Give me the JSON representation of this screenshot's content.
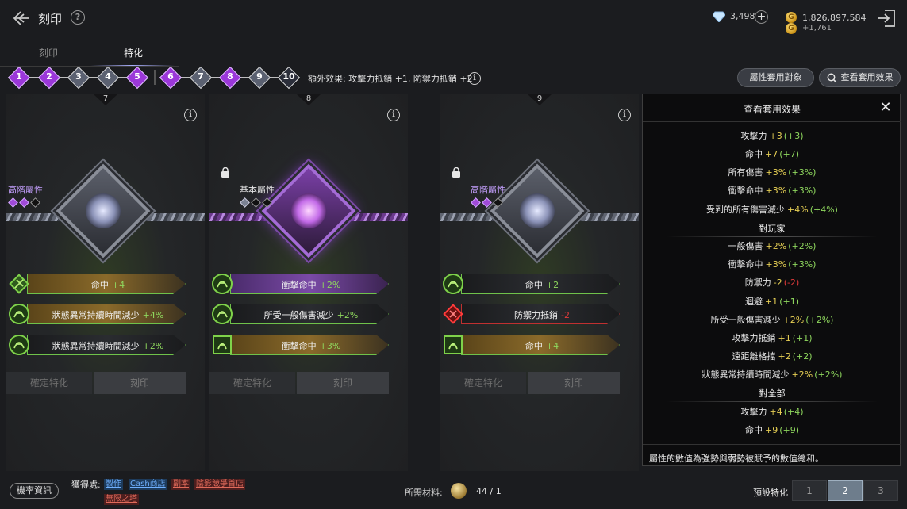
{
  "header": {
    "title": "刻印",
    "diamonds": "3,498",
    "gold": "1,826,897,584",
    "gold_sub": "+1,761"
  },
  "tabs": [
    {
      "label": "刻印",
      "active": false
    },
    {
      "label": "特化",
      "active": true
    }
  ],
  "steps": [
    {
      "num": "1",
      "style": "purple"
    },
    {
      "num": "2",
      "style": "purple"
    },
    {
      "num": "3",
      "style": "grey"
    },
    {
      "num": "4",
      "style": "grey"
    },
    {
      "num": "5",
      "style": "purple"
    },
    {
      "num": "6",
      "style": "purple"
    },
    {
      "num": "7",
      "style": "grey"
    },
    {
      "num": "8",
      "style": "purple"
    },
    {
      "num": "9",
      "style": "grey"
    },
    {
      "num": "10",
      "style": "dark"
    }
  ],
  "bonus_text": "額外效果: 攻擊力抵銷 +1, 防禦力抵銷 +2",
  "buttons": {
    "apply_target": "屬性套用對象",
    "view_effects": "查看套用效果"
  },
  "panels": [
    {
      "num": "7",
      "tier": "高階屬性",
      "tier_style": "purple",
      "locked": false,
      "stats": [
        {
          "name": "命中",
          "value": "+4",
          "bar": "gold",
          "negative": false
        },
        {
          "name": "狀態異常持續時間減少",
          "value": "+4%",
          "bar": "gold",
          "negative": false
        },
        {
          "name": "狀態異常持續時間減少",
          "value": "+2%",
          "bar": "dark",
          "negative": false
        }
      ],
      "confirm": "確定特化",
      "engrave": "刻印"
    },
    {
      "num": "8",
      "tier": "基本屬性",
      "tier_style": "basic",
      "locked": true,
      "stats": [
        {
          "name": "衝擊命中",
          "value": "+2%",
          "bar": "purple",
          "negative": false
        },
        {
          "name": "所受一般傷害減少",
          "value": "+2%",
          "bar": "dark",
          "negative": false
        },
        {
          "name": "衝擊命中",
          "value": "+3%",
          "bar": "gold",
          "negative": false
        }
      ],
      "confirm": "確定特化",
      "engrave": "刻印"
    },
    {
      "num": "9",
      "tier": "高階屬性",
      "tier_style": "purple",
      "locked": true,
      "stats": [
        {
          "name": "命中",
          "value": "+2",
          "bar": "dark",
          "negative": false
        },
        {
          "name": "防禦力抵銷",
          "value": "-2",
          "bar": "dark",
          "negative": true
        },
        {
          "name": "命中",
          "value": "+4",
          "bar": "gold",
          "negative": false
        }
      ],
      "confirm": "確定特化",
      "engrave": "刻印"
    }
  ],
  "overlay": {
    "title": "查看套用效果",
    "rows": [
      {
        "type": "row",
        "name": "攻擊力",
        "v1": "+3",
        "v2": "(+3)"
      },
      {
        "type": "row",
        "name": "命中",
        "v1": "+7",
        "v2": "(+7)"
      },
      {
        "type": "row",
        "name": "所有傷害",
        "v1": "+3%",
        "v2": "(+3%)"
      },
      {
        "type": "row",
        "name": "衝擊命中",
        "v1": "+3%",
        "v2": "(+3%)"
      },
      {
        "type": "row",
        "name": "受到的所有傷害減少",
        "v1": "+4%",
        "v2": "(+4%)"
      },
      {
        "type": "section",
        "name": "對玩家"
      },
      {
        "type": "row",
        "name": "一般傷害",
        "v1": "+2%",
        "v2": "(+2%)"
      },
      {
        "type": "row",
        "name": "衝擊命中",
        "v1": "+3%",
        "v2": "(+3%)"
      },
      {
        "type": "row",
        "name": "防禦力",
        "v1": "-2",
        "v2": "(-2)",
        "negative": true
      },
      {
        "type": "row",
        "name": "迴避",
        "v1": "+1",
        "v2": "(+1)"
      },
      {
        "type": "row",
        "name": "所受一般傷害減少",
        "v1": "+2%",
        "v2": "(+2%)"
      },
      {
        "type": "row",
        "name": "攻擊力抵銷",
        "v1": "+1",
        "v2": "(+1)"
      },
      {
        "type": "row",
        "name": "遠距離格擋",
        "v1": "+2",
        "v2": "(+2)"
      },
      {
        "type": "row",
        "name": "狀態異常持續時間減少",
        "v1": "+2%",
        "v2": "(+2%)"
      },
      {
        "type": "section",
        "name": "對全部"
      },
      {
        "type": "row",
        "name": "攻擊力",
        "v1": "+4",
        "v2": "(+4)"
      },
      {
        "type": "row",
        "name": "命中",
        "v1": "+9",
        "v2": "(+9)"
      }
    ],
    "footer": "屬性的數值為強勢與弱勢被賦予的數值總和。"
  },
  "bottom": {
    "prob_btn": "機率資訊",
    "source_label": "獲得處:",
    "sources": [
      {
        "label": "製作",
        "style": "blue"
      },
      {
        "label": "Cash商店",
        "style": "blue"
      },
      {
        "label": "副本",
        "style": "red"
      },
      {
        "label": "陰影競爭首店",
        "style": "red"
      },
      {
        "label": "無限之塔",
        "style": "red"
      }
    ],
    "material_label": "所需材料:",
    "material_count": "44 / 1",
    "preset_label": "預設特化",
    "presets": [
      "1",
      "2",
      "3"
    ],
    "active_preset": "2"
  }
}
